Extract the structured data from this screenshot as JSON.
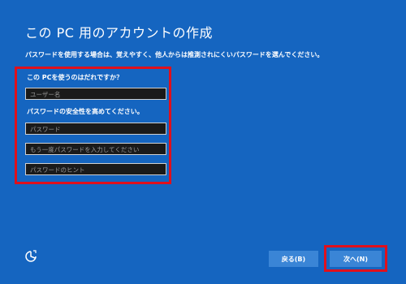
{
  "page": {
    "title": "この PC 用のアカウントの作成",
    "subtitle": "パスワードを使用する場合は、覚えやすく、他人からは推測されにくいパスワードを選んでください。"
  },
  "form": {
    "who_label": "この PCを使うのはだれですか？",
    "security_label": "パスワードの安全性を高めてください。",
    "username_placeholder": "ユーザー名",
    "password_placeholder": "パスワード",
    "password_confirm_placeholder": "もう一度パスワードを入力してください",
    "hint_placeholder": "パスワードのヒント"
  },
  "buttons": {
    "back_label": "戻る(B)",
    "next_label": "次へ(N)"
  },
  "icons": {
    "ease_of_access": "ease-of-access-icon"
  },
  "colors": {
    "background": "#1565c0",
    "highlight": "#e0101c",
    "button": "#3a85d6"
  }
}
